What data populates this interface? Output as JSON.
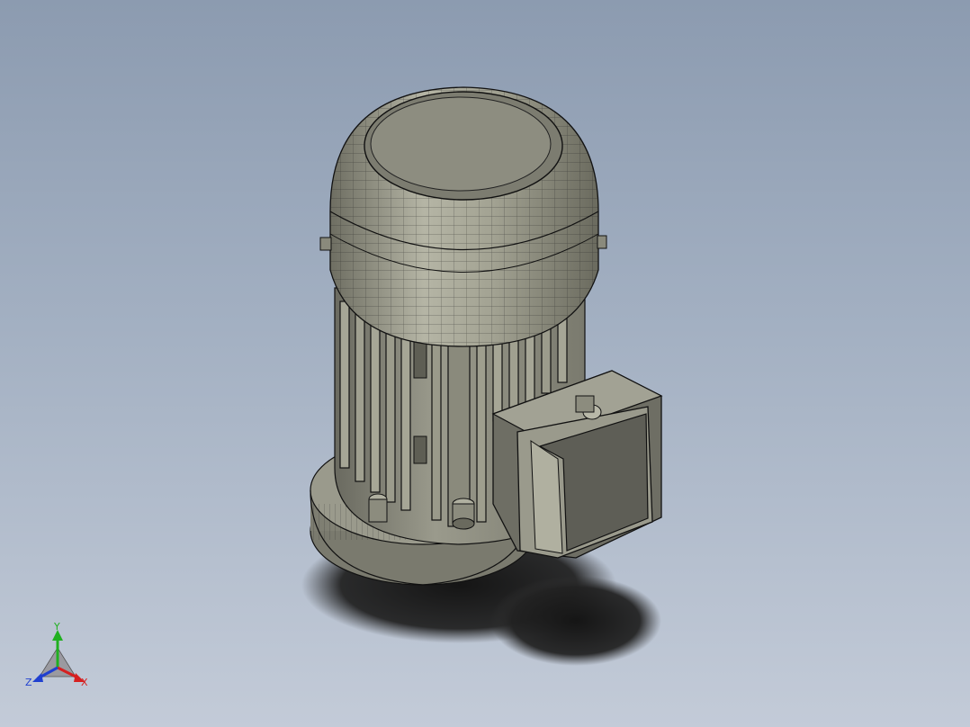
{
  "viewport": {
    "background_top": "#8c9bb0",
    "background_bottom": "#c3cbd8",
    "model": "electric-motor"
  },
  "colors": {
    "body_fill": "#8a8a7c",
    "dome_fill": "#9a9a8a",
    "edge": "#1a1a1a",
    "shadow": "#1c1c1c",
    "axis_x": "#d62020",
    "axis_y": "#20b020",
    "axis_z": "#2040d0"
  },
  "triad": {
    "x_label": "X",
    "y_label": "Y",
    "z_label": "Z"
  }
}
